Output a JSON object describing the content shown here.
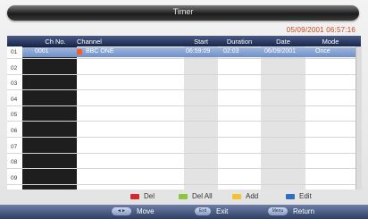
{
  "title": "Timer",
  "datetime": "05/09/2001 06:57:16",
  "columns": {
    "ch_no": "Ch No.",
    "channel": "Channel",
    "start": "Start",
    "duration": "Duration",
    "date": "Date",
    "mode": "Mode"
  },
  "row_numbers": [
    "01",
    "02",
    "03",
    "04",
    "05",
    "06",
    "07",
    "08",
    "09"
  ],
  "selected_entry": {
    "ch_no": "0001",
    "channel": "BBC ONE",
    "start": "06:59:09",
    "duration": "02:03",
    "date": "06/09/2001",
    "mode": "Once"
  },
  "legend": {
    "del": "Del",
    "del_all": "Del All",
    "add": "Add",
    "edit": "Edit"
  },
  "footer": {
    "move_key": "◄►",
    "move_label": "Move",
    "exit_key": "Exit",
    "exit_label": "Exit",
    "return_key": "Menu",
    "return_label": "Return"
  },
  "colors": {
    "red": "#d8262c",
    "green": "#8cc63f",
    "yellow": "#f2c230",
    "blue": "#2f6fc4",
    "accent": "#c8471e"
  }
}
